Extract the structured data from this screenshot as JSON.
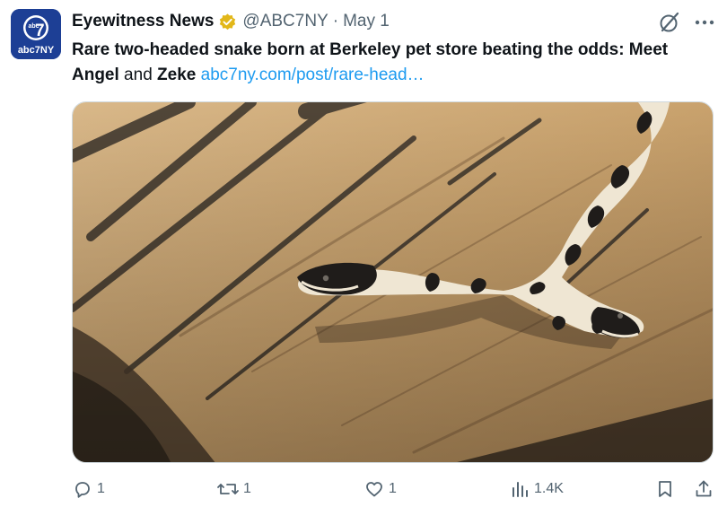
{
  "account": {
    "name": "Eyewitness News",
    "handle": "@ABC7NY",
    "separator": "·",
    "date": "May 1",
    "avatar_text_top": "abc",
    "avatar_text_num": "7",
    "avatar_text_bottom": "abc7NY",
    "verified_color": "#e2b719"
  },
  "tweet": {
    "text_bold_1": "Rare two-headed snake born at Berkeley pet store beating the odds: Meet Angel",
    "text_plain": " and ",
    "text_bold_2": "Zeke",
    "link": "abc7ny.com/post/rare-head…"
  },
  "media": {
    "alt_subject": "two-headed snake on wooden board"
  },
  "actions": {
    "reply_count": "1",
    "repost_count": "1",
    "like_count": "1",
    "views_count": "1.4K"
  },
  "icons": {
    "grok": "grok-icon",
    "more": "more-icon",
    "reply": "reply-icon",
    "repost": "repost-icon",
    "like": "heart-icon",
    "views": "views-icon",
    "bookmark": "bookmark-icon",
    "share": "share-icon"
  },
  "colors": {
    "link": "#1d9bf0",
    "muted": "#536471",
    "avatar_bg": "#1d3f95"
  }
}
